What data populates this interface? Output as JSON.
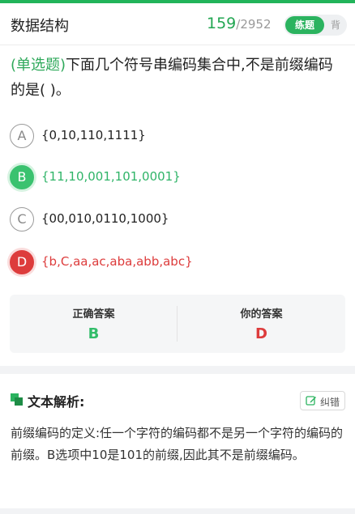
{
  "header": {
    "title": "数据结构",
    "counter_current": "159",
    "counter_sep": "/",
    "counter_total": "2952",
    "mode_practice": "练题",
    "mode_recite": "背"
  },
  "question": {
    "type_label": "(单选题)",
    "text": "下面几个符号串编码集合中,不是前缀编码的是(        )。"
  },
  "options": [
    {
      "letter": "A",
      "text": "{0,10,110,1111}",
      "state": "normal"
    },
    {
      "letter": "B",
      "text": "{11,10,001,101,0001}",
      "state": "correct"
    },
    {
      "letter": "C",
      "text": "{00,010,0110,1000}",
      "state": "normal"
    },
    {
      "letter": "D",
      "text": "{b,C,aa,ac,aba,abb,abc}",
      "state": "wrong"
    }
  ],
  "answers": {
    "correct_label": "正确答案",
    "correct_value": "B",
    "yours_label": "你的答案",
    "yours_value": "D"
  },
  "analysis": {
    "title": "文本解析:",
    "report_label": "纠错",
    "text": "前缀编码的定义:任一个字符的编码都不是另一个字符的编码的前缀。B选项中10是101的前缀,因此其不是前缀编码。"
  },
  "colors": {
    "accent": "#22b45a",
    "correct": "#3ac26f",
    "wrong": "#dd3c3c"
  },
  "icons": [
    "squares-icon",
    "edit-icon"
  ]
}
